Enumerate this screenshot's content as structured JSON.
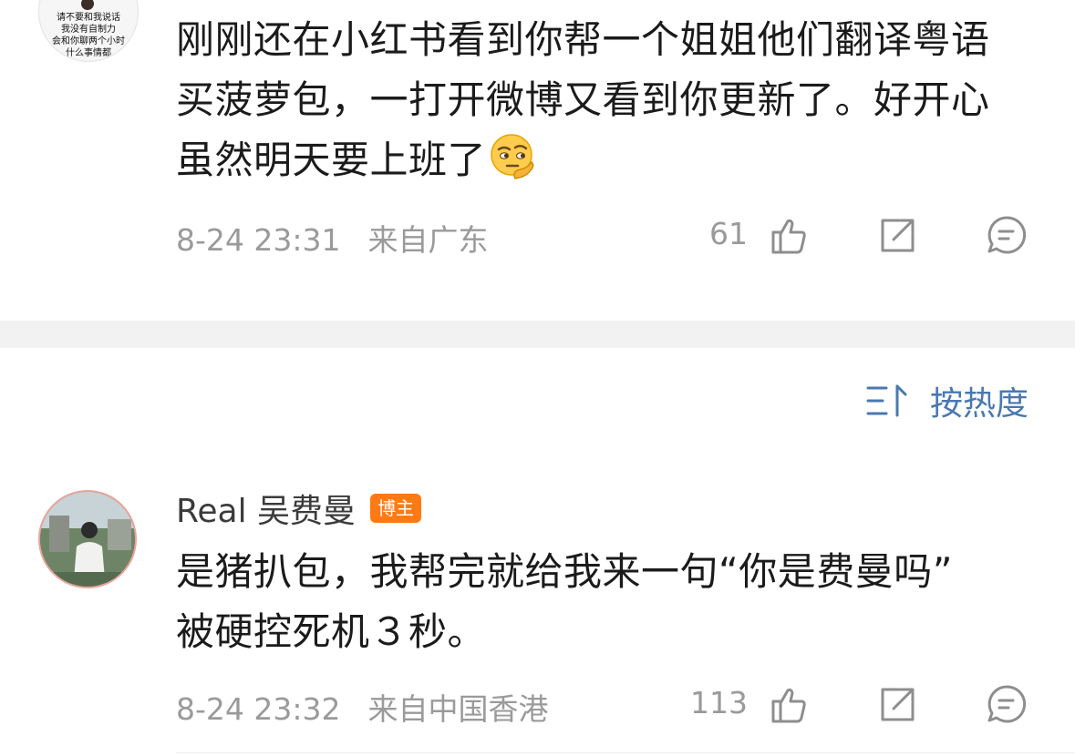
{
  "comment1": {
    "avatar_text": [
      "请不要和我说话",
      "我没有自制力",
      "会和你聊两个小时",
      "什么事情都"
    ],
    "lines": [
      "刚刚还在小红书看到你帮一个姐姐他们翻译粤语",
      "买菠萝包，一打开微博又看到你更新了。好开心",
      "虽然明天要上班了"
    ],
    "emoji": "thinking-face-emoji",
    "time": "8-24 23:31",
    "location": "来自广东",
    "likes": "61"
  },
  "sort": {
    "icon": "sort-icon",
    "label": "按热度"
  },
  "comment2": {
    "username": "Real 吴费曼",
    "badge": "博主",
    "lines": [
      "是猪扒包，我帮完就给我来一句“你是费曼吗”",
      "被硬控死机３秒。"
    ],
    "time": "8-24 23:32",
    "location": "来自中国香港",
    "likes": "113"
  },
  "colors": {
    "accent_blue": "#4a78b0",
    "badge_orange": "#ff7a12",
    "meta_gray": "#9a9a9a",
    "divider": "#f2f2f2"
  }
}
